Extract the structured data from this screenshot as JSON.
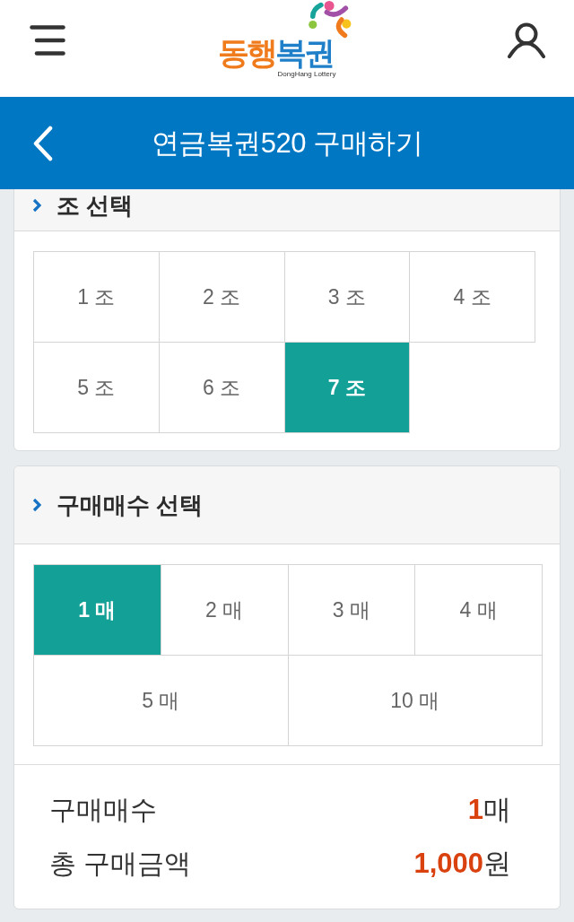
{
  "header": {
    "logo": {
      "wordmark": [
        {
          "text": "동행",
          "color": "#f07b1c"
        },
        {
          "text": "복권",
          "color": "#1f7fc8"
        }
      ],
      "tagline": "DongHang Lottery"
    }
  },
  "title_bar": {
    "title": "연금복권520 구매하기"
  },
  "team_selection": {
    "title": "조 선택",
    "options": [
      {
        "label": "1 조",
        "selected": false
      },
      {
        "label": "2 조",
        "selected": false
      },
      {
        "label": "3 조",
        "selected": false
      },
      {
        "label": "4 조",
        "selected": false
      },
      {
        "label": "5 조",
        "selected": false
      },
      {
        "label": "6 조",
        "selected": false
      },
      {
        "label": "7 조",
        "selected": true
      }
    ]
  },
  "quantity_selection": {
    "title": "구매매수 선택",
    "options": [
      {
        "label": "1 매",
        "selected": true,
        "kind": "regular"
      },
      {
        "label": "2 매",
        "selected": false,
        "kind": "regular"
      },
      {
        "label": "3 매",
        "selected": false,
        "kind": "regular"
      },
      {
        "label": "4 매",
        "selected": false,
        "kind": "regular"
      },
      {
        "label": "5 매",
        "selected": false,
        "kind": "wide"
      },
      {
        "label": "10 매",
        "selected": false,
        "kind": "wide"
      }
    ]
  },
  "summary": [
    {
      "label": "구매매수",
      "value": "**1**매"
    },
    {
      "label": "총 구매금액",
      "value": "**1,000**원"
    }
  ]
}
